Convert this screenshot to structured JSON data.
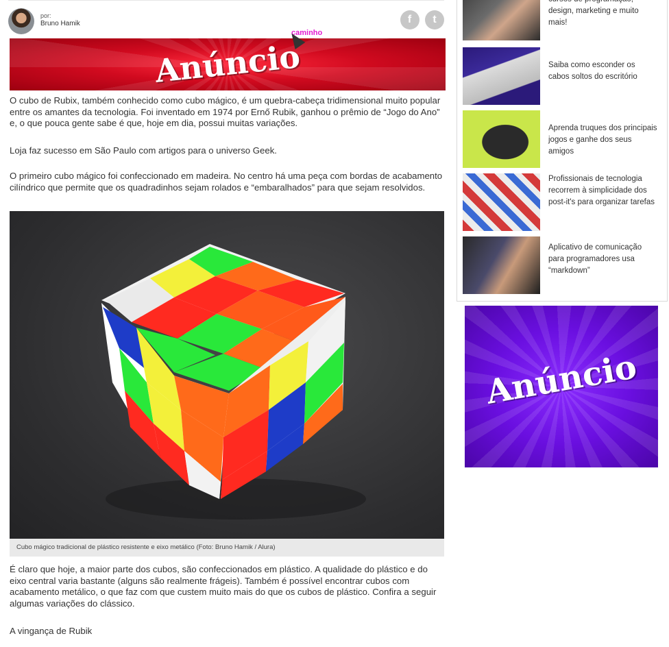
{
  "author": {
    "prefix": "por:",
    "name": "Bruno Hamik"
  },
  "social": {
    "facebook_glyph": "f",
    "twitter_glyph": "t"
  },
  "cursor_label": "caminho",
  "ads": {
    "top": "Anúncio",
    "side": "Anúncio"
  },
  "article": {
    "p1": "O cubo de Rubix, também conhecido como cubo mágico, é um quebra-cabeça tridimensional muito popular entre os amantes da tecnologia. Foi inventado em 1974 por Ernő Rubik, ganhou o prêmio de “Jogo do Ano” e, o que pouca gente sabe é que, hoje em dia, possui muitas variações.",
    "p2": "Loja faz sucesso em São Paulo com artigos para o universo Geek.",
    "p3": "O primeiro cubo mágico foi confeccionado em madeira. No centro há uma peça com bordas de acabamento cilíndrico que permite que os quadradinhos sejam rolados e “embaralhados” para que sejam resolvidos.",
    "caption": "Cubo mágico tradicional de plástico resistente e eixo metálico (Foto: Bruno Hamik / Alura)",
    "p4": "É claro que hoje, a maior parte dos cubos, são confeccionados em plástico. A qualidade do plástico e do eixo central varia bastante (alguns são realmente frágeis). Também é possível encontrar cubos com acabamento metálico, o que faz com que custem muito mais do que os cubos de plástico. Confira a seguir algumas variações do clássico.",
    "p5": "A vingança de Rubik"
  },
  "sidebar": {
    "items": [
      {
        "text": "cursos de programação, design, marketing e muito mais!"
      },
      {
        "text": "Saiba como esconder os cabos soltos do escritório"
      },
      {
        "text": "Aprenda truques dos principais jogos e ganhe dos seus amigos"
      },
      {
        "text": "Profissionais de tecnologia recorrem à simplicidade dos post-it's para organizar tarefas"
      },
      {
        "text": "Aplicativo de comunicação para programadores usa “markdown”"
      }
    ]
  },
  "colors": {
    "ad_top": "#d10a1f",
    "ad_side": "#6a0fe0",
    "cursor_label": "#e31bd2"
  },
  "icons": [
    "facebook-icon",
    "twitter-icon",
    "mouse-cursor-icon"
  ]
}
